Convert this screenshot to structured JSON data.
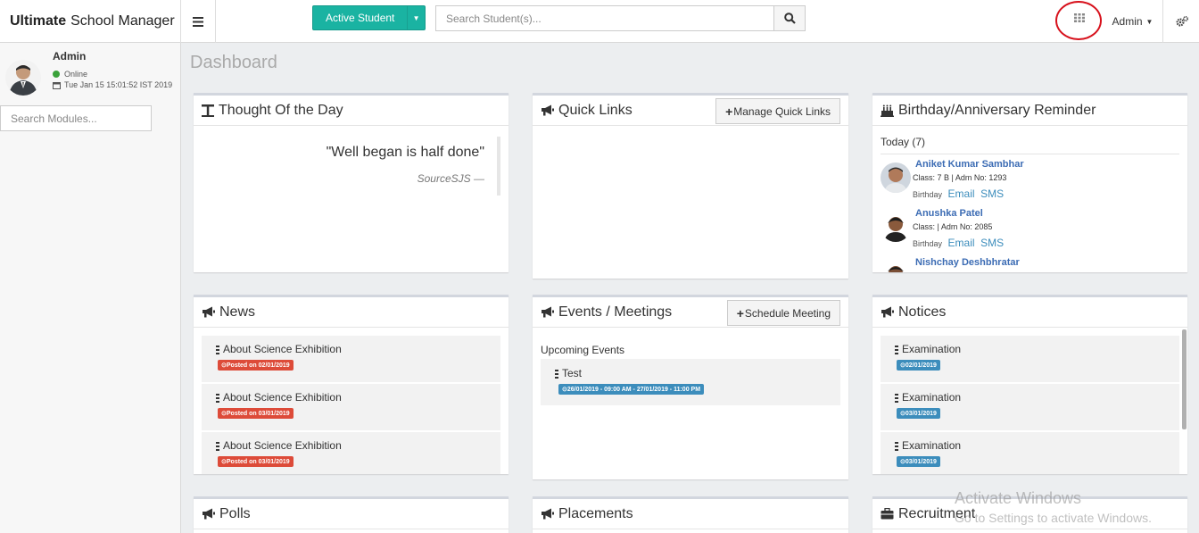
{
  "header": {
    "brand_bold": "Ultimate",
    "brand_rest": "School Manager",
    "active_student_label": "Active Student",
    "search_placeholder": "Search Student(s)...",
    "admin_label": "Admin"
  },
  "sidebar": {
    "user_name": "Admin",
    "status": "Online",
    "datetime": "Tue Jan 15 15:01:52 IST 2019",
    "module_search_placeholder": "Search Modules..."
  },
  "page": {
    "title": "Dashboard"
  },
  "thought": {
    "title": "Thought Of the Day",
    "quote": "\"Well began is half done\"",
    "source": "SourceSJS —"
  },
  "quick_links": {
    "title": "Quick Links",
    "button": "Manage Quick Links"
  },
  "birthday": {
    "title": "Birthday/Anniversary Reminder",
    "today": "Today (7)",
    "people": [
      {
        "name": "Aniket Kumar Sambhar",
        "class_info": "Class: 7 B | Adm No: 1293",
        "type": "Birthday",
        "email": "Email",
        "sms": "SMS"
      },
      {
        "name": "Anushka Patel",
        "class_info": "Class: | Adm No: 2085",
        "type": "Birthday",
        "email": "Email",
        "sms": "SMS"
      },
      {
        "name": "Nishchay Deshbhratar"
      }
    ]
  },
  "news": {
    "title": "News",
    "items": [
      {
        "title": "About Science Exhibition",
        "date": "Posted on 02/01/2019"
      },
      {
        "title": "About Science Exhibition",
        "date": "Posted on 03/01/2019"
      },
      {
        "title": "About Science Exhibition",
        "date": "Posted on 03/01/2019"
      }
    ]
  },
  "events": {
    "title": "Events / Meetings",
    "button": "Schedule Meeting",
    "upcoming": "Upcoming Events",
    "items": [
      {
        "title": "Test",
        "date": "26/01/2019 - 09:00 AM - 27/01/2019 - 11:00 PM"
      }
    ]
  },
  "notices": {
    "title": "Notices",
    "items": [
      {
        "title": "Examination",
        "date": "02/01/2019"
      },
      {
        "title": "Examination",
        "date": "03/01/2019"
      },
      {
        "title": "Examination",
        "date": "03/01/2019"
      }
    ]
  },
  "polls": {
    "title": "Polls"
  },
  "placements": {
    "title": "Placements"
  },
  "recruitment": {
    "title": "Recruitment"
  },
  "watermark": {
    "line1": "Activate Windows",
    "line2": "Go to Settings to activate Windows."
  },
  "colors": {
    "accent": "#1ab3a2",
    "news_badge": "#dd4b39",
    "notice_badge": "#3c8dbc",
    "annotation_circle": "#d7111c"
  }
}
